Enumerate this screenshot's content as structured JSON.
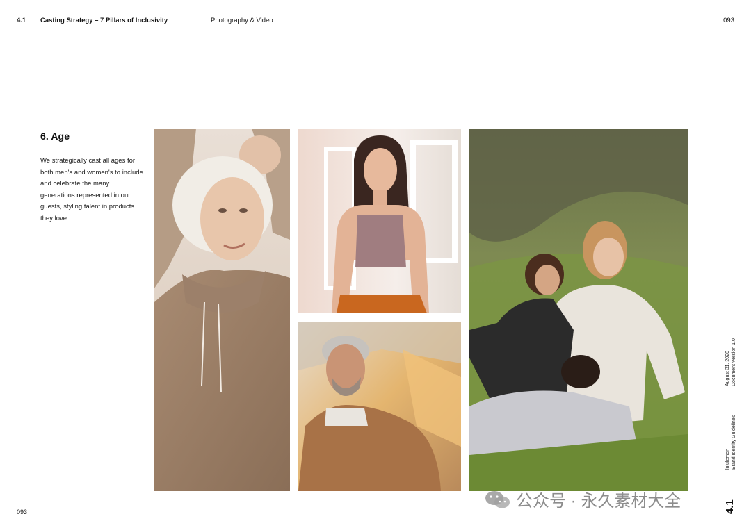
{
  "header": {
    "section_number": "4.1",
    "title": "Casting Strategy – 7 Pillars of Inclusivity",
    "category": "Photography & Video",
    "page_number": "093"
  },
  "content": {
    "heading": "6. Age",
    "body": "We strategically cast all ages for both men's and women's to include and celebrate the many generations represented in our guests, styling talent in products they love."
  },
  "sidebar": {
    "date": "August 31, 2020",
    "version": "Document Version 1.0",
    "brand": "lululemon",
    "guidelines": "Brand Identity Guidelines"
  },
  "footer": {
    "page_number": "093",
    "section_tag": "4.1"
  },
  "watermark": {
    "text": "公众号 · 永久素材大全"
  },
  "colors": {
    "text": "#111111",
    "background": "#ffffff"
  }
}
